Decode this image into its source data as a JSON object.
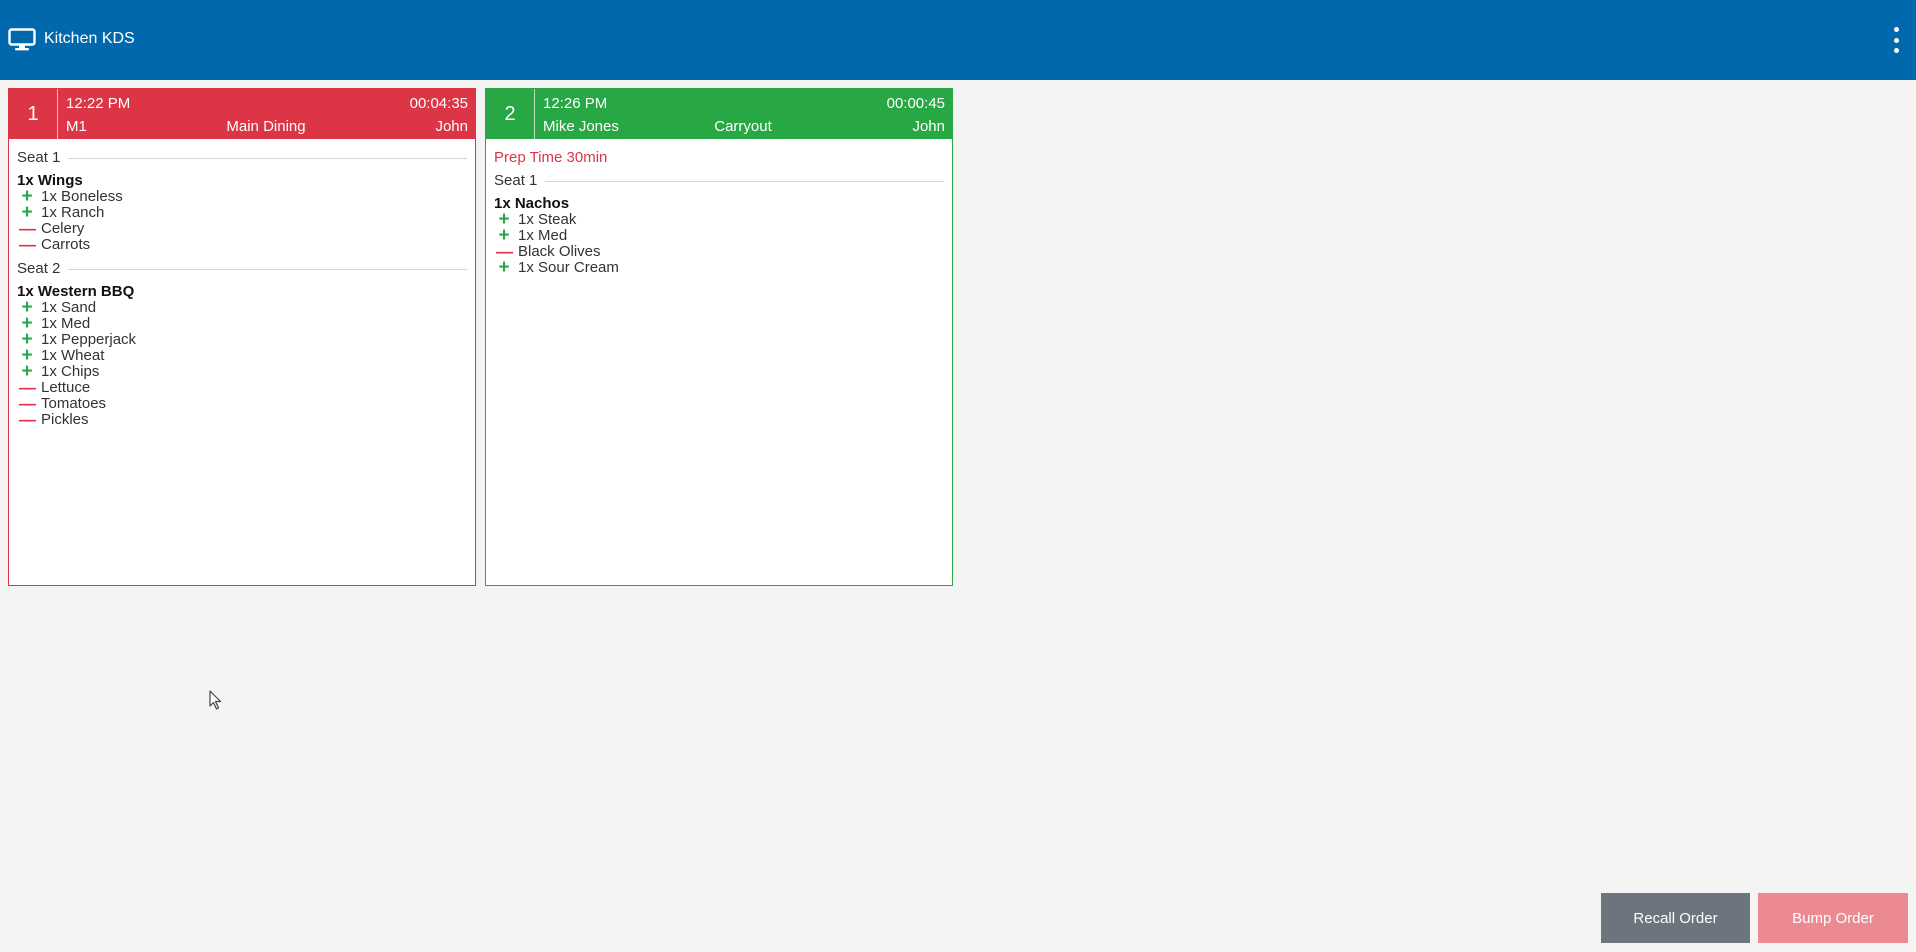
{
  "header": {
    "title": "Kitchen KDS",
    "menu_icon": "more-vert-icon",
    "app_icon": "monitor-icon"
  },
  "tickets": [
    {
      "number": "1",
      "time": "12:22 PM",
      "elapsed": "00:04:35",
      "reference": "M1",
      "destination": "Main Dining",
      "server": "John",
      "status_color": "#dc3545",
      "seats": [
        {
          "label": "Seat 1",
          "items": [
            {
              "name": "1x Wings",
              "modifiers": [
                {
                  "type": "add",
                  "text": "1x Boneless"
                },
                {
                  "type": "add",
                  "text": "1x Ranch"
                },
                {
                  "type": "remove",
                  "text": "Celery"
                },
                {
                  "type": "remove",
                  "text": "Carrots"
                }
              ]
            }
          ]
        },
        {
          "label": "Seat 2",
          "items": [
            {
              "name": "1x Western BBQ",
              "modifiers": [
                {
                  "type": "add",
                  "text": "1x Sand"
                },
                {
                  "type": "add",
                  "text": "1x Med"
                },
                {
                  "type": "add",
                  "text": "1x Pepperjack"
                },
                {
                  "type": "add",
                  "text": "1x Wheat"
                },
                {
                  "type": "add",
                  "text": "1x Chips"
                },
                {
                  "type": "remove",
                  "text": "Lettuce"
                },
                {
                  "type": "remove",
                  "text": "Tomatoes"
                },
                {
                  "type": "remove",
                  "text": "Pickles"
                }
              ]
            }
          ]
        }
      ]
    },
    {
      "number": "2",
      "time": "12:26 PM",
      "elapsed": "00:00:45",
      "reference": "Mike Jones",
      "destination": "Carryout",
      "server": "John",
      "status_color": "#28a745",
      "note": "Prep Time 30min",
      "seats": [
        {
          "label": "Seat 1",
          "items": [
            {
              "name": "1x Nachos",
              "modifiers": [
                {
                  "type": "add",
                  "text": "1x Steak"
                },
                {
                  "type": "add",
                  "text": "1x Med"
                },
                {
                  "type": "remove",
                  "text": "Black Olives"
                },
                {
                  "type": "add",
                  "text": "1x Sour Cream"
                }
              ]
            }
          ]
        }
      ]
    }
  ],
  "actions": {
    "recall_label": "Recall Order",
    "bump_label": "Bump Order"
  }
}
